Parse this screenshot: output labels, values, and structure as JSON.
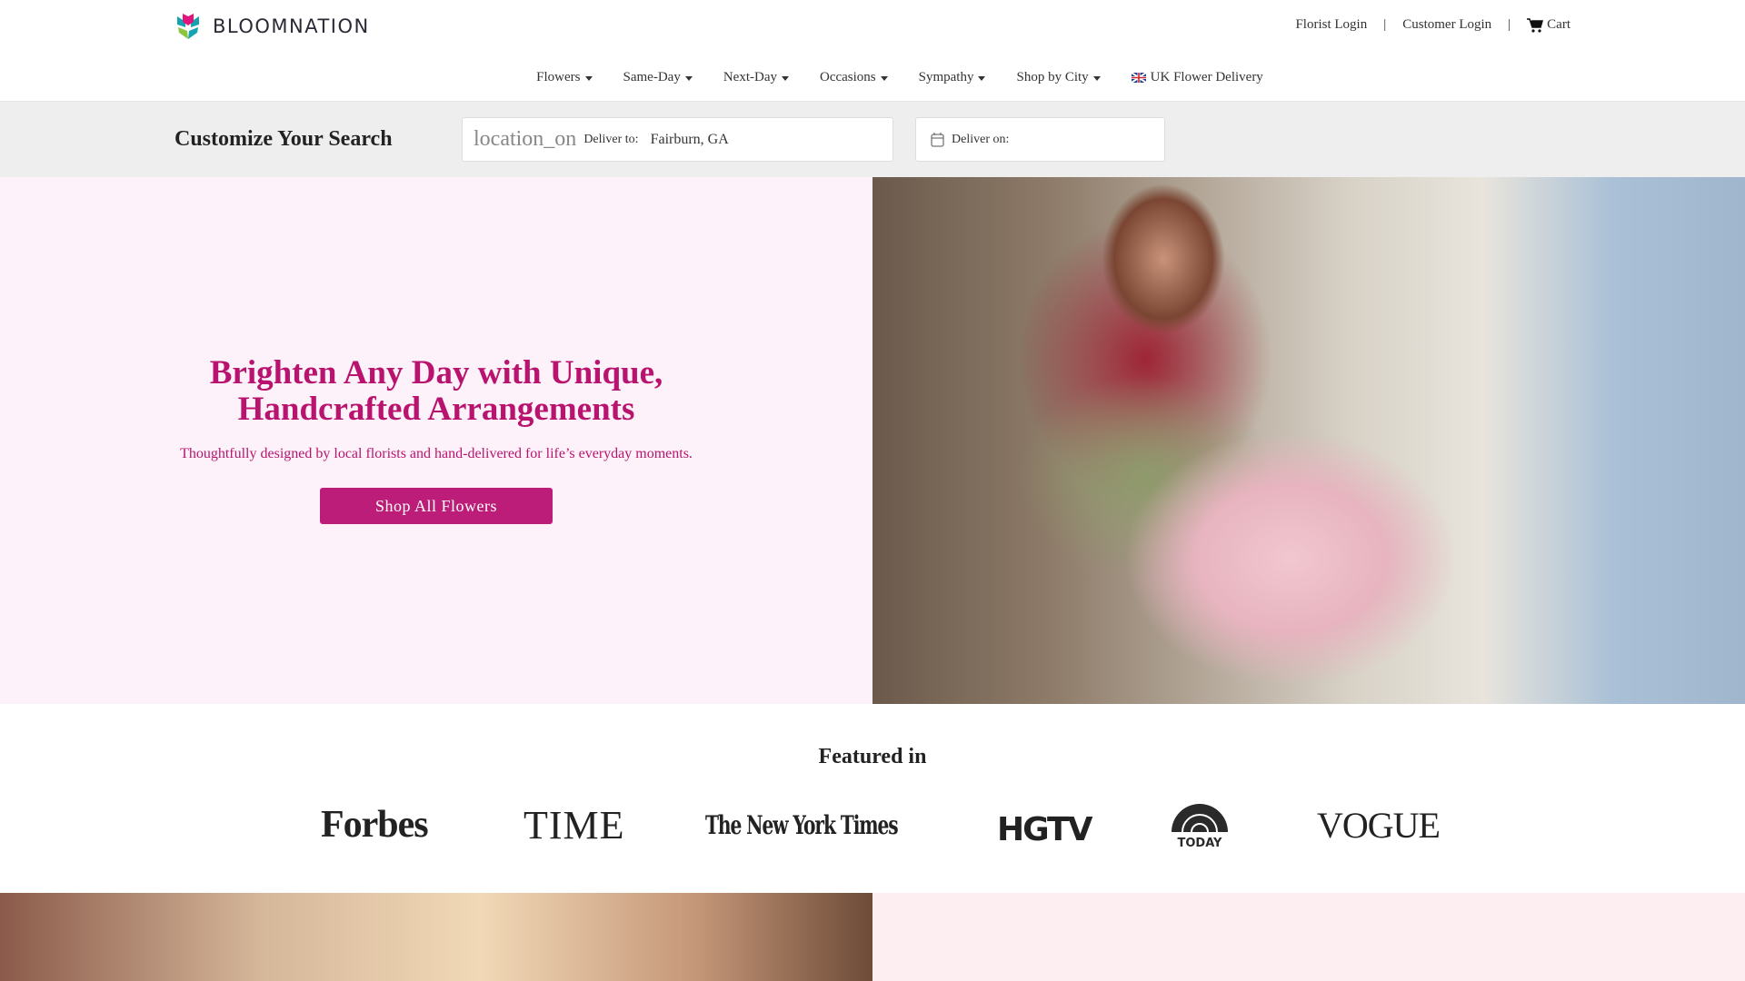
{
  "brand": {
    "name": "BLOOMNATION"
  },
  "top_links": {
    "florist_login": "Florist Login",
    "customer_login": "Customer Login",
    "cart": "Cart",
    "separator": "|"
  },
  "nav": {
    "items": [
      {
        "label": "Flowers"
      },
      {
        "label": "Same-Day"
      },
      {
        "label": "Next-Day"
      },
      {
        "label": "Occasions"
      },
      {
        "label": "Sympathy"
      },
      {
        "label": "Shop by City"
      }
    ],
    "uk": "UK Flower Delivery"
  },
  "search": {
    "title": "Customize Your Search",
    "location_glyph": "location_on",
    "deliver_to_label": "Deliver to:",
    "deliver_to_value": "Fairburn, GA",
    "deliver_on_label": "Deliver on:"
  },
  "hero": {
    "headline_1": "Brighten Any Day with Unique,",
    "headline_2": "Handcrafted Arrangements",
    "subtitle": "Thoughtfully designed by local florists and hand-delivered for life’s everyday moments.",
    "cta": "Shop All Flowers"
  },
  "featured": {
    "title": "Featured in",
    "logos": [
      "Forbes",
      "TIME",
      "The New York Times",
      "HGTV",
      "TODAY",
      "VOGUE"
    ]
  },
  "colors": {
    "accent": "#bb1d78",
    "hero_bg": "#fdf2f9",
    "search_bg": "#eeeeee"
  }
}
